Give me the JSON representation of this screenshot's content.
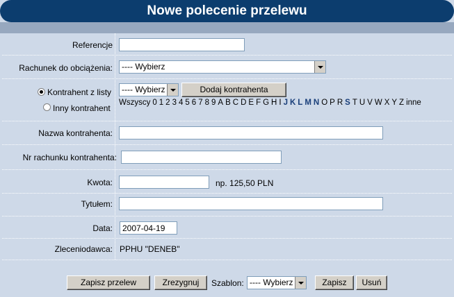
{
  "title": "Nowe polecenie przelewu",
  "fields": {
    "referencje": {
      "label": "Referencje",
      "value": ""
    },
    "rachunek": {
      "label": "Rachunek do obciążenia:",
      "selected": "---- Wybierz"
    },
    "kontrahent": {
      "radio_list_label": "Kontrahent z listy",
      "radio_other_label": "Inny kontrahent",
      "selected": "---- Wybierz",
      "add_button": "Dodaj kontrahenta",
      "alphabet": [
        {
          "t": "Wszyscy",
          "link": false
        },
        {
          "t": "0",
          "link": false
        },
        {
          "t": "1",
          "link": false
        },
        {
          "t": "2",
          "link": false
        },
        {
          "t": "3",
          "link": false
        },
        {
          "t": "4",
          "link": false
        },
        {
          "t": "5",
          "link": false
        },
        {
          "t": "6",
          "link": false
        },
        {
          "t": "7",
          "link": false
        },
        {
          "t": "8",
          "link": false
        },
        {
          "t": "9",
          "link": false
        },
        {
          "t": "A",
          "link": false
        },
        {
          "t": "B",
          "link": false
        },
        {
          "t": "C",
          "link": false
        },
        {
          "t": "D",
          "link": false
        },
        {
          "t": "E",
          "link": false
        },
        {
          "t": "F",
          "link": false
        },
        {
          "t": "G",
          "link": false
        },
        {
          "t": "H",
          "link": false
        },
        {
          "t": "I",
          "link": false
        },
        {
          "t": "J",
          "link": true
        },
        {
          "t": "K",
          "link": true
        },
        {
          "t": "L",
          "link": true
        },
        {
          "t": "M",
          "link": true
        },
        {
          "t": "N",
          "link": true
        },
        {
          "t": "O",
          "link": false
        },
        {
          "t": "P",
          "link": false
        },
        {
          "t": "R",
          "link": false
        },
        {
          "t": "S",
          "link": true
        },
        {
          "t": "T",
          "link": false
        },
        {
          "t": "U",
          "link": false
        },
        {
          "t": "V",
          "link": false
        },
        {
          "t": "W",
          "link": false
        },
        {
          "t": "X",
          "link": false
        },
        {
          "t": "Y",
          "link": false
        },
        {
          "t": "Z",
          "link": false
        },
        {
          "t": "inne",
          "link": false
        }
      ]
    },
    "nazwa": {
      "label": "Nazwa kontrahenta:",
      "value": ""
    },
    "nr_rachunku": {
      "label": "Nr rachunku kontrahenta:",
      "value": ""
    },
    "kwota": {
      "label": "Kwota:",
      "value": "",
      "hint": "np. 125,50 PLN"
    },
    "tytul": {
      "label": "Tytułem:",
      "value": ""
    },
    "data": {
      "label": "Data:",
      "value": "2007-04-19"
    },
    "zleceniodawca": {
      "label": "Zleceniodawca:",
      "value": "PPHU \"DENEB\""
    }
  },
  "footer": {
    "save": "Zapisz przelew",
    "cancel": "Zrezygnuj",
    "szablon_label": "Szablon:",
    "szablon_selected": "---- Wybierz",
    "save_template": "Zapisz",
    "delete_template": "Usuń"
  },
  "colors": {
    "title_bg": "#0c3d6e",
    "panel_bg": "#ced9e8",
    "link": "#1a3f7a"
  }
}
